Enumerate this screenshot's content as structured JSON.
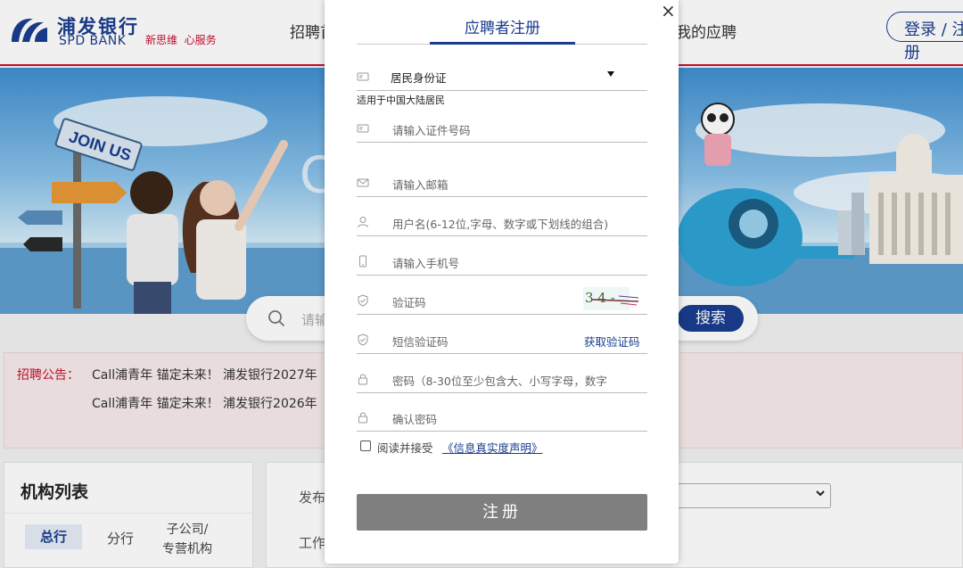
{
  "header": {
    "logo_cn": "浦发银行",
    "logo_en": "SPD BANK",
    "slogan": "新思维  心服务",
    "nav_left": "招聘首页",
    "nav_right": "我的应聘",
    "login": "登录 / 注册",
    "brand_color": "#1a3d8f",
    "accent_color": "#c8102e"
  },
  "banner": {
    "sign_text": "JOIN US"
  },
  "search": {
    "placeholder": "请输入职位关键字",
    "button": "搜索"
  },
  "notice": {
    "label": "招聘公告：",
    "items": [
      "Call浦青年 锚定未来！ 浦发银行2027年",
      "Call浦青年 锚定未来！ 浦发银行2026年"
    ]
  },
  "org": {
    "title": "机构列表",
    "tabs": [
      "总行",
      "分行",
      "子公司/\n专营机构"
    ]
  },
  "filters": {
    "labels": [
      "发布",
      "工作"
    ]
  },
  "modal": {
    "title": "应聘者注册",
    "close": "×",
    "id_type": {
      "value": "居民身份证",
      "hint": "适用于中国大陆居民"
    },
    "fields": {
      "id_number": "请输入证件号码",
      "email": "请输入邮箱",
      "username": "用户名(6-12位,字母、数字或下划线的组合)",
      "phone": "请输入手机号",
      "captcha": "验证码",
      "sms_code": "短信验证码",
      "password": "密码（8-30位至少包含大、小写字母，数字",
      "confirm_password": "确认密码"
    },
    "sms_link": "获取验证码",
    "captcha_text": "3 4 -",
    "agree_text": "阅读并接受",
    "agree_link": "《信息真实度声明》",
    "agree_checked": false,
    "register": "注册"
  }
}
